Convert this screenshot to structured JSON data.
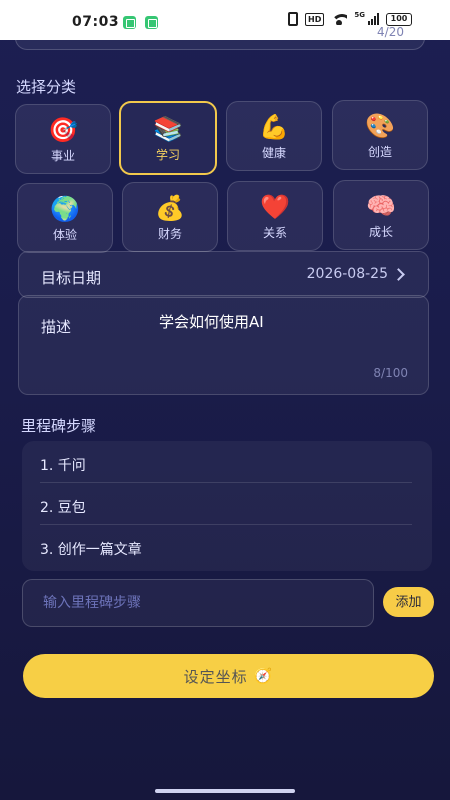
{
  "status_bar": {
    "time": "07:03",
    "hd": "HD",
    "signal": "5G",
    "battery": "100"
  },
  "top_field": {
    "counter": "4/20"
  },
  "category": {
    "label": "选择分类",
    "items": [
      {
        "label": "事业",
        "icon": "target-icon",
        "emoji": "🎯",
        "selected": false
      },
      {
        "label": "学习",
        "icon": "books-icon",
        "emoji": "📚",
        "selected": true
      },
      {
        "label": "健康",
        "icon": "flexed-biceps-icon",
        "emoji": "💪",
        "selected": false
      },
      {
        "label": "创造",
        "icon": "palette-icon",
        "emoji": "🎨",
        "selected": false
      },
      {
        "label": "体验",
        "icon": "globe-icon",
        "emoji": "🌍",
        "selected": false
      },
      {
        "label": "财务",
        "icon": "money-bag-icon",
        "emoji": "💰",
        "selected": false
      },
      {
        "label": "关系",
        "icon": "heart-icon",
        "emoji": "❤️",
        "selected": false
      },
      {
        "label": "成长",
        "icon": "brain-icon",
        "emoji": "🧠",
        "selected": false
      }
    ]
  },
  "target_date": {
    "label": "目标日期",
    "value": "2026-08-25"
  },
  "description": {
    "label": "描述",
    "value": "学会如何使用AI",
    "counter": "8/100"
  },
  "milestones": {
    "label": "里程碑步骤",
    "items": [
      "1. 千问",
      "2. 豆包",
      "3. 创作一篇文章"
    ],
    "input_placeholder": "输入里程碑步骤",
    "add_label": "添加"
  },
  "submit": {
    "label": "设定坐标",
    "icon": "compass-icon",
    "emoji": "🧭"
  },
  "colors": {
    "accent": "#f7cf45",
    "background": "#1c1f52"
  }
}
